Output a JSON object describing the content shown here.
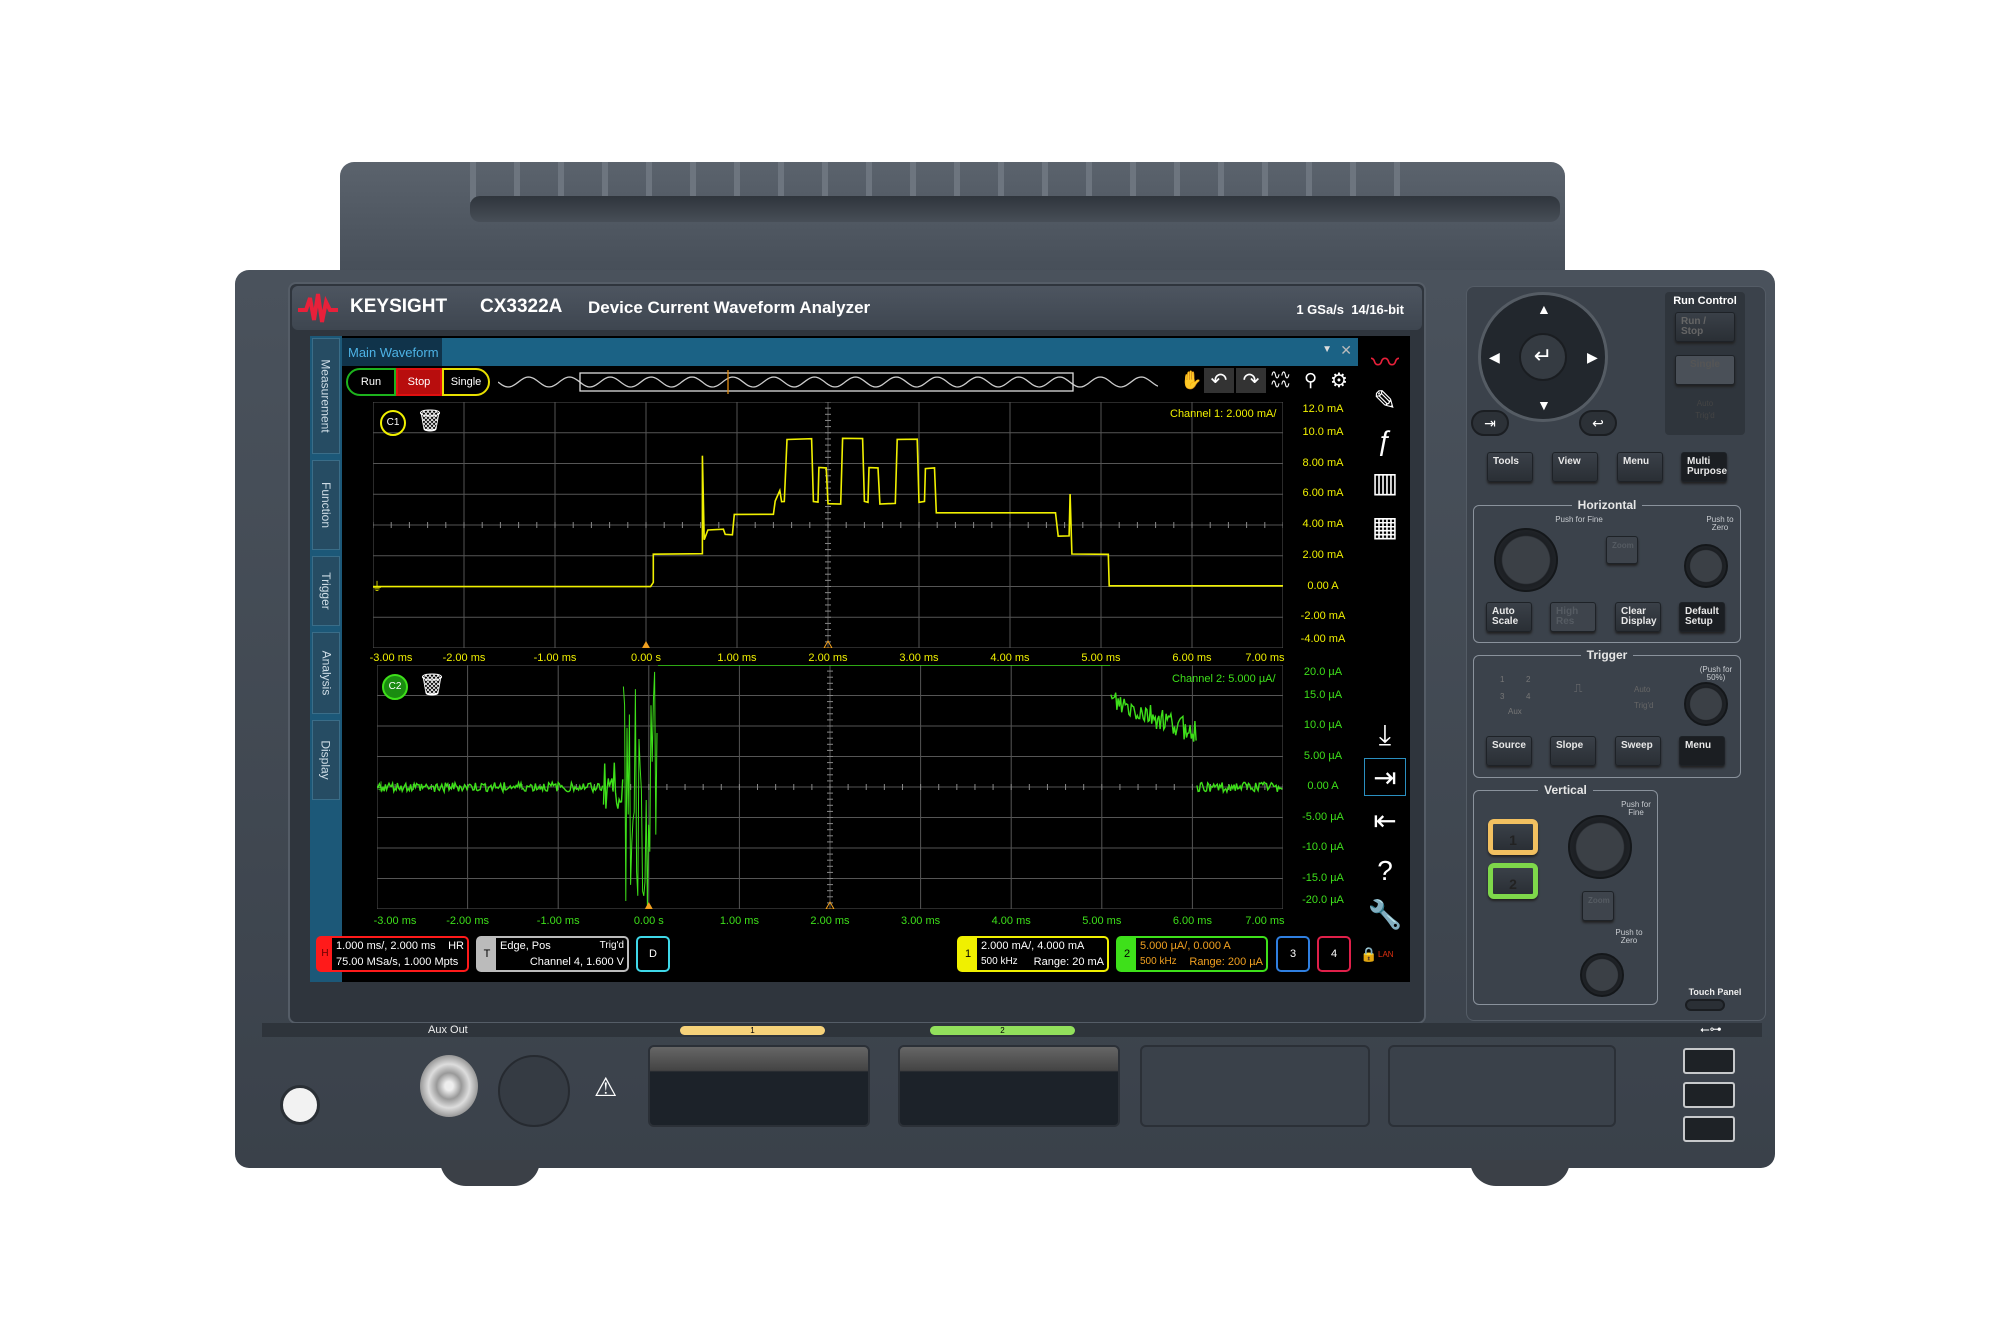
{
  "header": {
    "brand": "KEYSIGHT",
    "model": "CX3322A",
    "product_name": "Device Current Waveform Analyzer",
    "spec": "1 GSa/s  14/16-bit"
  },
  "screen": {
    "side_tabs": [
      "Measurement",
      "Function",
      "Trigger",
      "Analysis",
      "Display"
    ],
    "window_title": "Main Waveform",
    "run_controls": {
      "run": "Run",
      "stop": "Stop",
      "single": "Single"
    },
    "toolbar_icons": [
      "pan-hand-icon",
      "undo-icon",
      "redo-icon",
      "waveform-stack-icon",
      "probe-icon",
      "gear-icon"
    ],
    "right_icons": [
      "keysight-logo-icon",
      "probe-wave-icon",
      "function-icon",
      "layout-icon",
      "measurement-table-icon",
      "save-download-icon",
      "import-icon",
      "export-icon",
      "help-icon",
      "tools-wrench-icon"
    ],
    "plot1": {
      "badge": "C1",
      "scale_label": "Channel 1:  2.000 mA/"
    },
    "plot2": {
      "badge": "C2",
      "scale_label": "Channel 2:  5.000 µA/"
    },
    "status": {
      "horizontal": {
        "tag": "H",
        "line1": "1.000 ms/, 2.000 ms",
        "mode": "HR",
        "line2": "75.00 MSa/s, 1.000 Mpts"
      },
      "trigger": {
        "tag": "T",
        "line1": "Edge, Pos",
        "state": "Trig'd",
        "line2": "Channel 4, 1.600 V"
      },
      "digital": {
        "tag": "D"
      },
      "ch1": {
        "tag": "1",
        "line1": "2.000 mA/, 4.000 mA",
        "bw": "500 kHz",
        "range": "Range: 20 mA"
      },
      "ch2": {
        "tag": "2",
        "line1": "5.000 µA/, 0.000 A",
        "bw": "500 kHz",
        "range": "Range: 200 µA"
      },
      "ch3": {
        "tag": "3"
      },
      "ch4": {
        "tag": "4"
      },
      "lan": "LAN"
    }
  },
  "colors": {
    "ch1": "#f0f000",
    "ch2": "#3ee01a",
    "ch3": "#2f7fe0",
    "ch4": "#e0204a",
    "horizontal": "#ff1a1a",
    "trigger_marker": "#f0a020",
    "titlebar": "#1b6285"
  },
  "chart_data": [
    {
      "type": "line",
      "name": "Channel 1",
      "xlabel": "",
      "ylabel": "",
      "xlim": [
        -3,
        7
      ],
      "ylim": [
        -4,
        12
      ],
      "x_ticks": [
        "-3.00 ms",
        "-2.00 ms",
        "-1.00 ms",
        "0.00 s",
        "1.00 ms",
        "2.00 ms",
        "3.00 ms",
        "4.00 ms",
        "5.00 ms",
        "6.00 ms",
        "7.00 ms"
      ],
      "y_ticks": [
        "12.0 mA",
        "10.0 mA",
        "8.00 mA",
        "6.00 mA",
        "4.00 mA",
        "2.00 mA",
        "0.00 A",
        "-2.00 mA",
        "-4.00 mA"
      ],
      "x_unit": "ms",
      "y_unit": "mA",
      "grid": true,
      "points": [
        [
          -3,
          0
        ],
        [
          0.05,
          0
        ],
        [
          0.08,
          0.3
        ],
        [
          0.08,
          2.1
        ],
        [
          0.62,
          2.1
        ],
        [
          0.62,
          8.5
        ],
        [
          0.64,
          3.0
        ],
        [
          0.68,
          3.7
        ],
        [
          0.85,
          3.7
        ],
        [
          0.87,
          3.4
        ],
        [
          0.95,
          3.4
        ],
        [
          0.97,
          4.7
        ],
        [
          1.4,
          4.7
        ],
        [
          1.42,
          5.6
        ],
        [
          1.47,
          6.2
        ],
        [
          1.49,
          5.5
        ],
        [
          1.52,
          5.5
        ],
        [
          1.55,
          9.6
        ],
        [
          1.82,
          9.6
        ],
        [
          1.84,
          5.5
        ],
        [
          1.89,
          5.5
        ],
        [
          1.9,
          7.7
        ],
        [
          1.98,
          7.7
        ],
        [
          2.0,
          5.4
        ],
        [
          2.14,
          5.4
        ],
        [
          2.16,
          9.6
        ],
        [
          2.38,
          9.6
        ],
        [
          2.4,
          5.5
        ],
        [
          2.44,
          5.5
        ],
        [
          2.45,
          7.7
        ],
        [
          2.55,
          7.7
        ],
        [
          2.57,
          5.4
        ],
        [
          2.74,
          5.4
        ],
        [
          2.76,
          9.6
        ],
        [
          2.98,
          9.6
        ],
        [
          3.0,
          5.5
        ],
        [
          3.06,
          5.5
        ],
        [
          3.07,
          7.7
        ],
        [
          3.17,
          7.7
        ],
        [
          3.19,
          4.8
        ],
        [
          4.5,
          4.8
        ],
        [
          4.53,
          3.3
        ],
        [
          4.65,
          3.3
        ],
        [
          4.66,
          6.0
        ],
        [
          4.68,
          2.1
        ],
        [
          5.08,
          2.1
        ],
        [
          5.09,
          0.05
        ],
        [
          7,
          0.05
        ]
      ]
    },
    {
      "type": "line",
      "name": "Channel 2",
      "xlabel": "",
      "ylabel": "",
      "xlim": [
        -3,
        7
      ],
      "ylim": [
        -20,
        20
      ],
      "x_ticks": [
        "-3.00 ms",
        "-2.00 ms",
        "-1.00 ms",
        "0.00 s",
        "1.00 ms",
        "2.00 ms",
        "3.00 ms",
        "4.00 ms",
        "5.00 ms",
        "6.00 ms",
        "7.00 ms"
      ],
      "y_ticks": [
        "20.0 µA",
        "15.0 µA",
        "10.0 µA",
        "5.00 µA",
        "0.00 A",
        "-5.00 µA",
        "-10.0 µA",
        "-15.0 µA",
        "-20.0 µA"
      ],
      "x_unit": "ms",
      "y_unit": "µA",
      "grid": true,
      "segments": [
        {
          "points": [
            [
              -3,
              0
            ],
            [
              -0.5,
              0
            ]
          ],
          "noise": 0.8
        },
        {
          "points": [
            [
              -0.5,
              0
            ],
            [
              -0.28,
              0
            ]
          ],
          "noise": 4
        },
        {
          "points": [
            [
              -0.28,
              0
            ],
            [
              0.1,
              0
            ]
          ],
          "noise": 20,
          "clipped": true
        },
        {
          "points": [
            [
              0.1,
              20
            ],
            [
              5.1,
              20
            ]
          ],
          "noise": 0,
          "clipped": true
        },
        {
          "points": [
            [
              5.1,
              14
            ],
            [
              6.05,
              9
            ]
          ],
          "noise": 2
        },
        {
          "points": [
            [
              6.05,
              0
            ],
            [
              7,
              0
            ]
          ],
          "noise": 0.8
        }
      ]
    }
  ],
  "panel": {
    "run_control": {
      "title": "Run Control",
      "run_stop": "Run / Stop",
      "single": "Single",
      "status": [
        "Auto",
        "Trig'd"
      ]
    },
    "nav": [
      "up",
      "down",
      "left",
      "right",
      "enter"
    ],
    "row_buttons": [
      "Tools",
      "View",
      "Menu",
      "Multi Purpose"
    ],
    "horizontal": {
      "title": "Horizontal",
      "knob1_hint": "Push for Fine",
      "knob2_hint": "Push to Zero",
      "zoom": "Zoom",
      "buttons": [
        "Auto Scale",
        "High Res",
        "Clear Display",
        "Default Setup"
      ]
    },
    "trigger": {
      "title": "Trigger",
      "knob_hint": "(Push for 50%)",
      "sources": [
        "1",
        "2",
        "3",
        "4",
        "Aux"
      ],
      "modes": [
        "Auto",
        "Trig'd"
      ],
      "buttons": [
        "Source",
        "Slope",
        "Sweep",
        "Menu"
      ]
    },
    "vertical": {
      "title": "Vertical",
      "ch_buttons": [
        "1",
        "2"
      ],
      "knob1_hint": "Push for Fine",
      "zoom": "Zoom",
      "knob2_hint": "Push to Zero"
    },
    "touch_panel": "Touch Panel"
  },
  "front": {
    "aux_out": "Aux Out",
    "ch_leds": [
      "1",
      "2"
    ]
  }
}
